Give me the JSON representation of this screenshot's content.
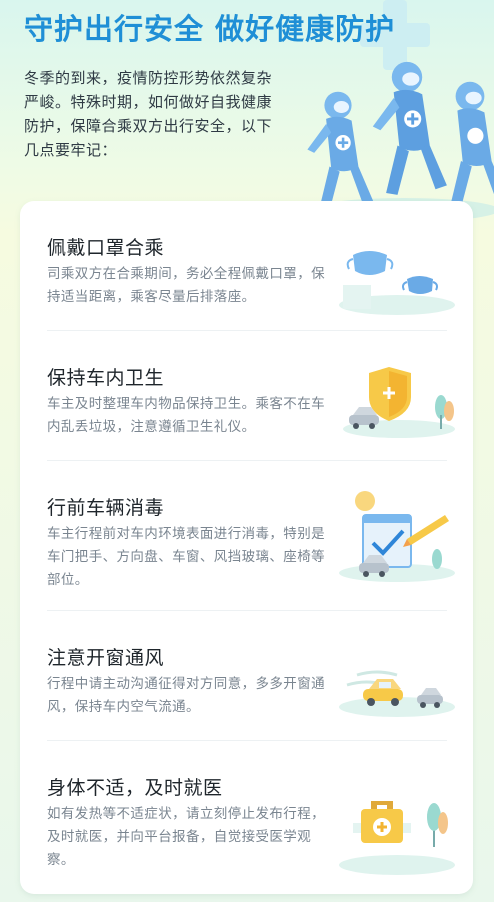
{
  "hero": {
    "title": "守护出行安全 做好健康防护",
    "intro": "冬季的到来，疫情防控形势依然复杂严峻。特殊时期，如何做好自我健康防护，保障合乘双方出行安全，以下几点要牢记："
  },
  "tips": [
    {
      "title": "佩戴口罩合乘",
      "desc": "司乘双方在合乘期间，务必全程佩戴口罩，保持适当距离，乘客尽量后排落座。",
      "icon": "mask-icon"
    },
    {
      "title": "保持车内卫生",
      "desc": "车主及时整理车内物品保持卫生。乘客不在车内乱丢垃圾，注意遵循卫生礼仪。",
      "icon": "shield-car-icon"
    },
    {
      "title": "行前车辆消毒",
      "desc": "车主行程前对车内环境表面进行消毒，特别是车门把手、方向盘、车窗、风挡玻璃、座椅等部位。",
      "icon": "checklist-icon"
    },
    {
      "title": "注意开窗通风",
      "desc": "行程中请主动沟通征得对方同意，多多开窗通风，保持车内空气流通。",
      "icon": "car-wind-icon"
    },
    {
      "title": "身体不适，及时就医",
      "desc": "如有发热等不适症状，请立刻停止发布行程，及时就医，并向平台报备，自觉接受医学观察。",
      "icon": "medical-kit-icon"
    }
  ],
  "colors": {
    "title_blue": "#1f8fd6",
    "suit_blue": "#7ab8ee",
    "accent_yellow": "#f7c948",
    "accent_teal": "#9ad9d0"
  }
}
